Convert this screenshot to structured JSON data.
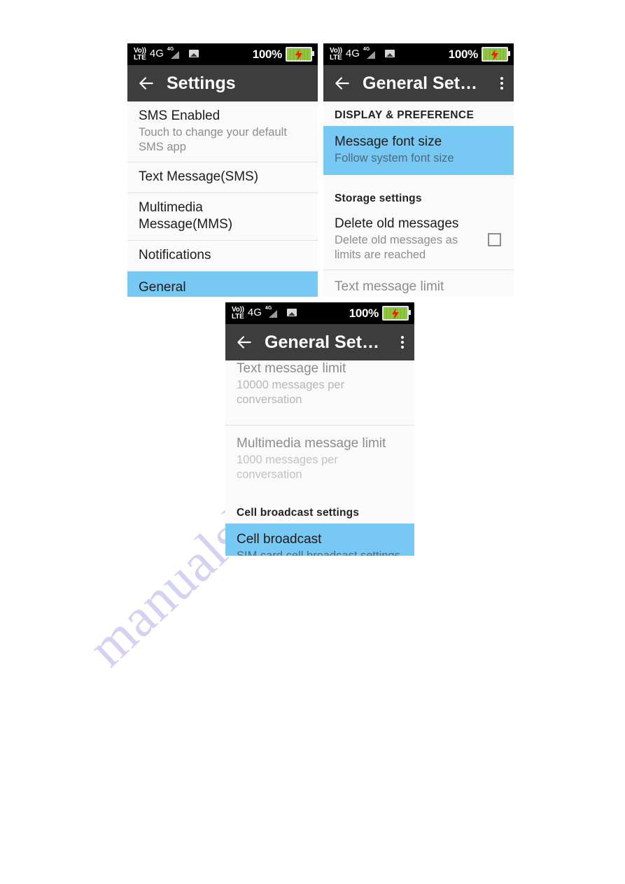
{
  "watermark": {
    "text": "manualshive.com"
  },
  "status_bar": {
    "volte_line1": "Vo))",
    "volte_line2": "LTE",
    "network": "4G",
    "signal_label": "4G",
    "battery_percent": "100%",
    "picture_icon": "picture-icon",
    "battery_icon": "battery-charging-icon",
    "colors": {
      "battery_green": "#8ec63f",
      "bolt_red": "#ee2200"
    }
  },
  "colors": {
    "appbar": "#3d3d3d",
    "highlight": "#77c8f2",
    "list_bg": "#fafafa",
    "primary_text": "#1c1c1c",
    "secondary_text": "#8d8d8d"
  },
  "screens": [
    {
      "id": "settings",
      "title": "Settings",
      "back_icon": "back-arrow-icon",
      "has_overflow": false,
      "rows": [
        {
          "title": "SMS Enabled",
          "sub": "Touch to change your default SMS app",
          "selected": false,
          "divider": false
        },
        {
          "title": "Text Message(SMS)",
          "sub": "",
          "selected": false,
          "divider": true
        },
        {
          "title": "Multimedia Message(MMS)",
          "sub": "",
          "selected": false,
          "divider": true
        },
        {
          "title": "Notifications",
          "sub": "",
          "selected": false,
          "divider": true
        },
        {
          "title": "General",
          "sub": "",
          "selected": true,
          "divider": false
        }
      ]
    },
    {
      "id": "general-settings-top",
      "title": "General Set…",
      "back_icon": "back-arrow-icon",
      "overflow_icon": "overflow-menu-icon",
      "has_overflow": true,
      "sections": [
        {
          "type": "header",
          "label": "DISPLAY & PREFERENCE"
        },
        {
          "type": "row",
          "title": "Message font size",
          "sub": "Follow system font size",
          "selected": true
        },
        {
          "type": "header",
          "label": "Storage settings"
        },
        {
          "type": "row",
          "title": "Delete old messages",
          "sub": "Delete old messages as limits are reached",
          "selected": false,
          "checkbox": true,
          "checked": false
        },
        {
          "type": "row",
          "title": "Text message limit",
          "sub": "",
          "selected": false,
          "dim": true,
          "divider": true
        }
      ]
    },
    {
      "id": "general-settings-bottom",
      "title": "General Set…",
      "back_icon": "back-arrow-icon",
      "overflow_icon": "overflow-menu-icon",
      "has_overflow": true,
      "sections": [
        {
          "type": "row",
          "title": "Text message limit",
          "sub": "10000 messages per conversation",
          "selected": false,
          "dim": true
        },
        {
          "type": "row",
          "title": "Multimedia message limit",
          "sub": "1000 messages per conversation",
          "selected": false,
          "dim": true,
          "divider": true
        },
        {
          "type": "header",
          "label": "Cell broadcast settings"
        },
        {
          "type": "row",
          "title": "Cell broadcast",
          "sub": "SIM card cell broadcast settings",
          "selected": true
        }
      ]
    }
  ]
}
